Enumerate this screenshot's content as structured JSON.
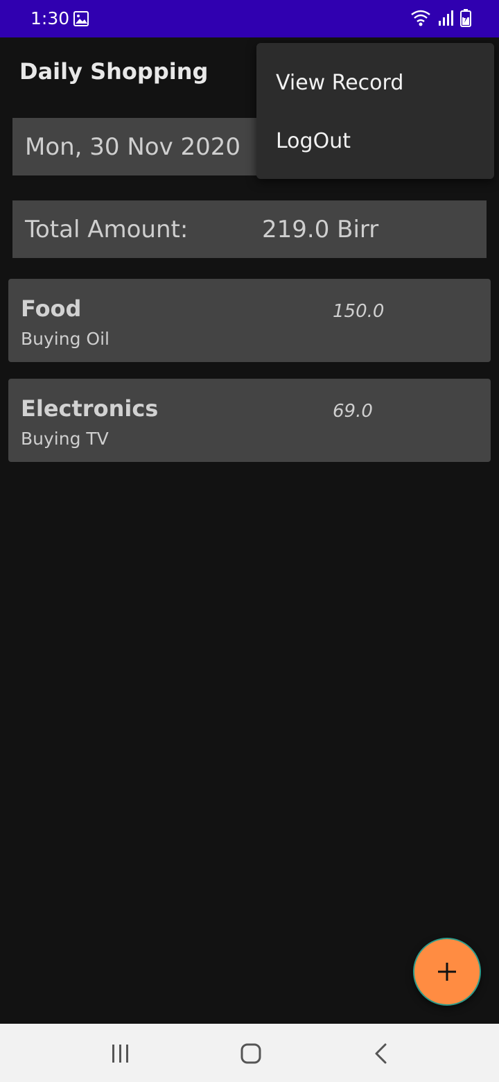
{
  "status_bar": {
    "time": "1:30",
    "icons": [
      "image-icon",
      "wifi-icon",
      "signal-icon",
      "battery-charging-icon"
    ],
    "background": "#3000b0"
  },
  "app": {
    "title": "Daily Shopping"
  },
  "date_field": {
    "value": "Mon, 30 Nov 2020"
  },
  "total": {
    "label": "Total Amount:",
    "value": "219.0 Birr"
  },
  "records": [
    {
      "category": "Food",
      "description": "Buying Oil",
      "amount": "150.0"
    },
    {
      "category": "Electronics",
      "description": "Buying TV",
      "amount": "69.0"
    }
  ],
  "overflow_menu": {
    "items": [
      {
        "label": "View Record"
      },
      {
        "label": "LogOut"
      }
    ]
  },
  "fab": {
    "icon": "plus-icon",
    "color": "#ff8c42"
  },
  "nav_bar": {
    "buttons": [
      "recents-icon",
      "home-icon",
      "back-icon"
    ]
  }
}
